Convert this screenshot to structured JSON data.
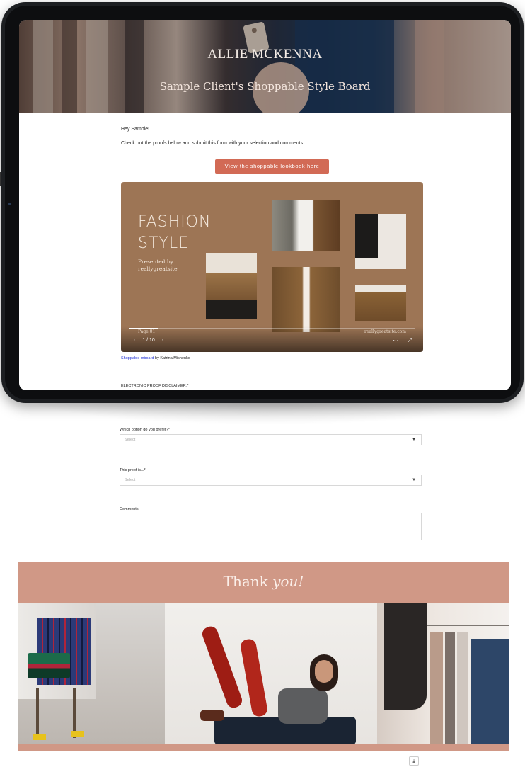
{
  "hero": {
    "brand": "ALLIE MCKENNA",
    "title": "Sample Client's Shoppable Style Board"
  },
  "intro": {
    "greeting": "Hey Sample!",
    "instructions": "Check out the proofs below and submit this form with your selection and comments:",
    "cta_label": "View the shoppable lookbook here"
  },
  "lookbook": {
    "title_line1": "FASHION",
    "title_line2": "STYLE",
    "presented_line1": "Presented by",
    "presented_line2": "reallygreatsite",
    "page_label": "Page 01",
    "site": "reallygreatsite.com",
    "page_counter": "1 / 10",
    "progress": 0.1
  },
  "credit": {
    "link_text": "Shoppable mboard",
    "suffix": " by Katrina Mishenko"
  },
  "disclaimer": "ELECTRONIC PROOF DISCLAIMER:*",
  "form": {
    "option_label": "Which option do you prefer?*",
    "option_placeholder": "Select",
    "proof_label": "This proof is...*",
    "proof_placeholder": "Select",
    "comments_label": "Comments:"
  },
  "thanks": {
    "word1": "Thank ",
    "word2": "you!"
  },
  "colors": {
    "cta": "#d26a55",
    "lookbook_bg": "#9d7555",
    "thanks_band": "#d09886",
    "link": "#2434d6"
  },
  "icons": {
    "select_caret": "caret-down-icon",
    "prev": "chevron-left-icon",
    "next": "chevron-right-icon",
    "more": "more-icon",
    "fullscreen": "fullscreen-icon",
    "download": "download-icon"
  }
}
